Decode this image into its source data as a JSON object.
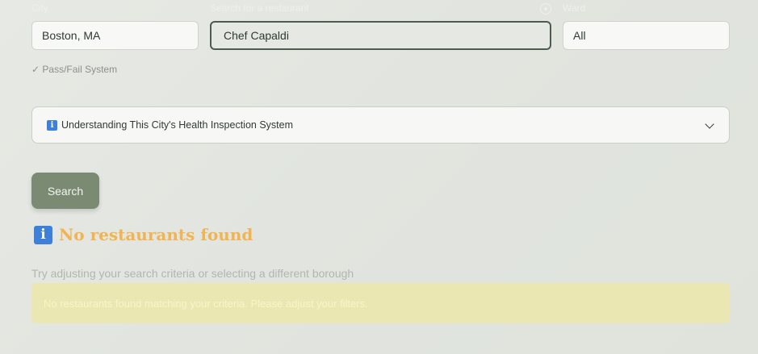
{
  "filters": {
    "city_label": "City",
    "city_value": "Boston, MA",
    "search_label": "Search for a restaurant",
    "search_value": "Chef Capaldi",
    "ward_label": "Ward",
    "ward_value": "All",
    "location_icon": "location-icon"
  },
  "system_note": "✓ Pass/Fail System",
  "expander": {
    "icon": "info-icon",
    "label": "Understanding This City's Health Inspection System"
  },
  "search_button": "Search",
  "results": {
    "icon": "info-icon",
    "title": "No restaurants found",
    "hint": "Try adjusting your search criteria or selecting a different borough",
    "alert": "No restaurants found matching your criteria. Please adjust your filters."
  },
  "colors": {
    "accent": "#7b8a72",
    "warning_title": "#f0b455",
    "alert_bg": "#ebe7b3",
    "info_blue": "#3d7fd9"
  }
}
